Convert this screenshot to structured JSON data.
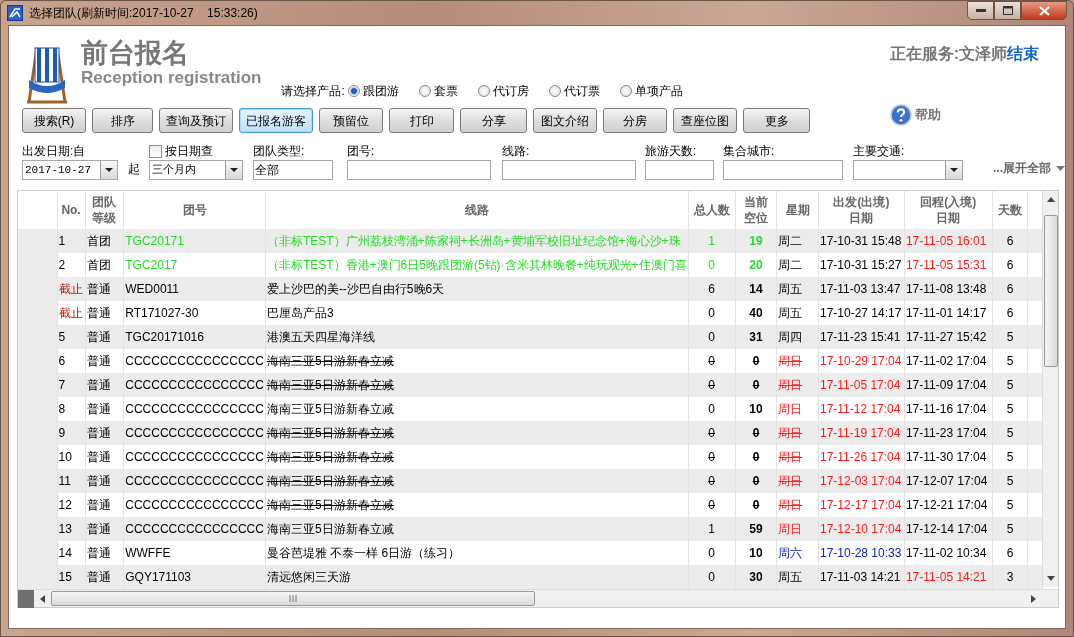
{
  "window": {
    "title": "选择团队(刷新时间:2017-10-27    15:33:26)"
  },
  "header": {
    "title": "前台报名",
    "subtitle": "Reception registration",
    "service_label": "正在服务:文泽师",
    "end_link": "结束"
  },
  "product": {
    "label": "请选择产品:",
    "options": [
      {
        "label": "跟团游",
        "selected": true
      },
      {
        "label": "套票",
        "selected": false
      },
      {
        "label": "代订房",
        "selected": false
      },
      {
        "label": "代订票",
        "selected": false
      },
      {
        "label": "单项产品",
        "selected": false
      }
    ]
  },
  "toolbar": {
    "buttons": [
      {
        "label": "搜索(R)",
        "selected": false
      },
      {
        "label": "排序",
        "selected": false
      },
      {
        "label": "查询及预订",
        "selected": false
      },
      {
        "label": "已报名游客",
        "selected": true
      },
      {
        "label": "预留位",
        "selected": false
      },
      {
        "label": "打印",
        "selected": false
      },
      {
        "label": "分享",
        "selected": false
      },
      {
        "label": "图文介绍",
        "selected": false
      },
      {
        "label": "分房",
        "selected": false
      },
      {
        "label": "查座位图",
        "selected": false
      },
      {
        "label": "更多",
        "selected": false
      }
    ],
    "help": "帮助"
  },
  "filters": {
    "date_label": "出发日期:自",
    "date_value": "2017-10-27",
    "from_word": "起",
    "by_date": {
      "label": "按日期查",
      "checked": false
    },
    "period_value": "三个月内",
    "fields": [
      {
        "kind": "text",
        "label": "团队类型:",
        "value": "全部"
      },
      {
        "kind": "text",
        "label": "团号:"
      },
      {
        "kind": "text",
        "label": "线路:"
      },
      {
        "kind": "text",
        "label": "旅游天数:"
      },
      {
        "kind": "text",
        "label": "集合城市:"
      },
      {
        "kind": "select",
        "label": "主要交通:"
      }
    ],
    "expand_link": "...展开全部"
  },
  "table": {
    "columns": [
      "No.",
      "团队等级",
      "团号",
      "线路",
      "总人数",
      "当前空位",
      "星期",
      "出发(出境)日期",
      "回程(入境)日期",
      "天数"
    ],
    "rows": [
      {
        "no": "1",
        "level": "首团",
        "code": "TGC20171",
        "route": "（非标TEST）广州荔枝湾涌+陈家祠+长洲岛+黄埔军校旧址纪念馆+海心沙+珠",
        "total": "1",
        "vacancy": "19",
        "weekday": "周二",
        "depart": "17-10-31 15:48",
        "return": "17-11-05 16:01",
        "days": "6",
        "kind": "featured",
        "closed": false,
        "struck": false,
        "day_red": false,
        "day_blue": false,
        "return_red": true
      },
      {
        "no": "2",
        "level": "首团",
        "code": "TGC2017",
        "route": "（非标TEST）香港+澳门6日5晚跟团游(5钻)·含米其林晚餐+纯玩观光+住澳门喜",
        "total": "0",
        "vacancy": "20",
        "weekday": "周二",
        "depart": "17-10-31 15:27",
        "return": "17-11-05 15:31",
        "days": "6",
        "kind": "featured",
        "closed": false,
        "struck": false,
        "day_red": false,
        "day_blue": false,
        "return_red": true
      },
      {
        "no": "截止",
        "level": "普通",
        "code": "WED0011",
        "route": "爱上沙巴的美--沙巴自由行5晚6天",
        "total": "6",
        "vacancy": "14",
        "weekday": "周五",
        "depart": "17-11-03 13:47",
        "return": "17-11-08 13:48",
        "days": "6",
        "kind": "normal",
        "closed": true,
        "struck": false,
        "day_red": false,
        "day_blue": false,
        "return_red": false
      },
      {
        "no": "截止",
        "level": "普通",
        "code": "RT171027-30",
        "route": "巴厘岛产品3",
        "total": "0",
        "vacancy": "40",
        "weekday": "周五",
        "depart": "17-10-27 14:17",
        "return": "17-11-01 14:17",
        "days": "6",
        "kind": "normal",
        "closed": true,
        "struck": false,
        "day_red": false,
        "day_blue": false,
        "return_red": false
      },
      {
        "no": "5",
        "level": "普通",
        "code": "TGC20171016",
        "route": "港澳五天四星海洋线",
        "total": "0",
        "vacancy": "31",
        "weekday": "周四",
        "depart": "17-11-23 15:41",
        "return": "17-11-27 15:42",
        "days": "5",
        "kind": "normal",
        "closed": false,
        "struck": false,
        "day_red": false,
        "day_blue": false,
        "return_red": false
      },
      {
        "no": "6",
        "level": "普通",
        "code": "CCCCCCCCCCCCCCCC",
        "route": "海南三亚5日游新春立减",
        "total": "0",
        "vacancy": "0",
        "weekday": "周日",
        "depart": "17-10-29 17:04",
        "return": "17-11-02 17:04",
        "days": "5",
        "kind": "normal",
        "closed": false,
        "struck": true,
        "day_red": true,
        "day_blue": false,
        "return_red": false
      },
      {
        "no": "7",
        "level": "普通",
        "code": "CCCCCCCCCCCCCCCC",
        "route": "海南三亚5日游新春立减",
        "total": "0",
        "vacancy": "0",
        "weekday": "周日",
        "depart": "17-11-05 17:04",
        "return": "17-11-09 17:04",
        "days": "5",
        "kind": "normal",
        "closed": false,
        "struck": true,
        "day_red": true,
        "day_blue": false,
        "return_red": false
      },
      {
        "no": "8",
        "level": "普通",
        "code": "CCCCCCCCCCCCCCCC",
        "route": "海南三亚5日游新春立减",
        "total": "0",
        "vacancy": "10",
        "weekday": "周日",
        "depart": "17-11-12 17:04",
        "return": "17-11-16 17:04",
        "days": "5",
        "kind": "normal",
        "closed": false,
        "struck": false,
        "day_red": true,
        "day_blue": false,
        "return_red": false
      },
      {
        "no": "9",
        "level": "普通",
        "code": "CCCCCCCCCCCCCCCC",
        "route": "海南三亚5日游新春立减",
        "total": "0",
        "vacancy": "0",
        "weekday": "周日",
        "depart": "17-11-19 17:04",
        "return": "17-11-23 17:04",
        "days": "5",
        "kind": "normal",
        "closed": false,
        "struck": true,
        "day_red": true,
        "day_blue": false,
        "return_red": false
      },
      {
        "no": "10",
        "level": "普通",
        "code": "CCCCCCCCCCCCCCCC",
        "route": "海南三亚5日游新春立减",
        "total": "0",
        "vacancy": "0",
        "weekday": "周日",
        "depart": "17-11-26 17:04",
        "return": "17-11-30 17:04",
        "days": "5",
        "kind": "normal",
        "closed": false,
        "struck": true,
        "day_red": true,
        "day_blue": false,
        "return_red": false
      },
      {
        "no": "11",
        "level": "普通",
        "code": "CCCCCCCCCCCCCCCC",
        "route": "海南三亚5日游新春立减",
        "total": "0",
        "vacancy": "0",
        "weekday": "周日",
        "depart": "17-12-03 17:04",
        "return": "17-12-07 17:04",
        "days": "5",
        "kind": "normal",
        "closed": false,
        "struck": true,
        "day_red": true,
        "day_blue": false,
        "return_red": false
      },
      {
        "no": "12",
        "level": "普通",
        "code": "CCCCCCCCCCCCCCCC",
        "route": "海南三亚5日游新春立减",
        "total": "0",
        "vacancy": "0",
        "weekday": "周日",
        "depart": "17-12-17 17:04",
        "return": "17-12-21 17:04",
        "days": "5",
        "kind": "normal",
        "closed": false,
        "struck": true,
        "day_red": true,
        "day_blue": false,
        "return_red": false
      },
      {
        "no": "13",
        "level": "普通",
        "code": "CCCCCCCCCCCCCCCC",
        "route": "海南三亚5日游新春立减",
        "total": "1",
        "vacancy": "59",
        "weekday": "周日",
        "depart": "17-12-10 17:04",
        "return": "17-12-14 17:04",
        "days": "5",
        "kind": "normal",
        "closed": false,
        "struck": false,
        "day_red": true,
        "day_blue": false,
        "return_red": false
      },
      {
        "no": "14",
        "level": "普通",
        "code": "WWFFE",
        "route": "曼谷芭堤雅 不泰一样 6日游（练习）",
        "total": "0",
        "vacancy": "10",
        "weekday": "周六",
        "depart": "17-10-28 10:33",
        "return": "17-11-02 10:34",
        "days": "6",
        "kind": "normal",
        "closed": false,
        "struck": false,
        "day_red": false,
        "day_blue": true,
        "return_red": false
      },
      {
        "no": "15",
        "level": "普通",
        "code": "GQY171103",
        "route": "清远悠闲三天游",
        "total": "0",
        "vacancy": "30",
        "weekday": "周五",
        "depart": "17-11-03 14:21",
        "return": "17-11-05 14:21",
        "days": "3",
        "kind": "normal",
        "closed": false,
        "struck": false,
        "day_red": false,
        "day_blue": false,
        "return_red": true
      }
    ]
  }
}
